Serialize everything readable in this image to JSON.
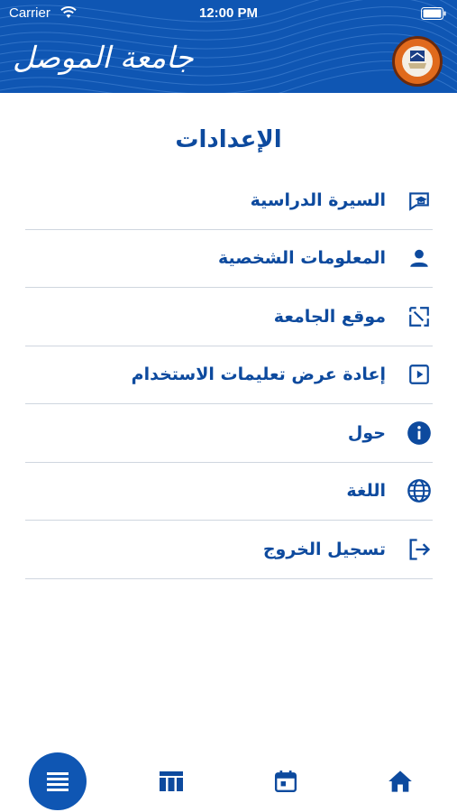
{
  "status_bar": {
    "carrier": "Carrier",
    "time": "12:00 PM"
  },
  "header": {
    "university_name": "جامعة الموصل",
    "logo": "university-seal"
  },
  "page": {
    "title": "الإعدادات"
  },
  "menu": {
    "items": [
      {
        "label": "السيرة الدراسية",
        "icon": "graduation-cap-icon"
      },
      {
        "label": "المعلومات الشخصية",
        "icon": "person-icon"
      },
      {
        "label": "موقع الجامعة",
        "icon": "external-link-icon"
      },
      {
        "label": "إعادة عرض تعليمات الاستخدام",
        "icon": "play-icon"
      },
      {
        "label": "حول",
        "icon": "info-icon"
      },
      {
        "label": "اللغة",
        "icon": "globe-icon"
      },
      {
        "label": "تسجيل الخروج",
        "icon": "logout-icon"
      }
    ]
  },
  "tab_bar": {
    "tabs": [
      {
        "name": "menu",
        "icon": "list-icon",
        "active": true
      },
      {
        "name": "table",
        "icon": "table-icon",
        "active": false
      },
      {
        "name": "calendar",
        "icon": "calendar-icon",
        "active": false
      },
      {
        "name": "home",
        "icon": "home-icon",
        "active": false
      }
    ]
  },
  "colors": {
    "primary": "#0f56b3",
    "text": "#0d4a9e",
    "divider": "#cfd6df",
    "logo_orange": "#e06a1c"
  }
}
